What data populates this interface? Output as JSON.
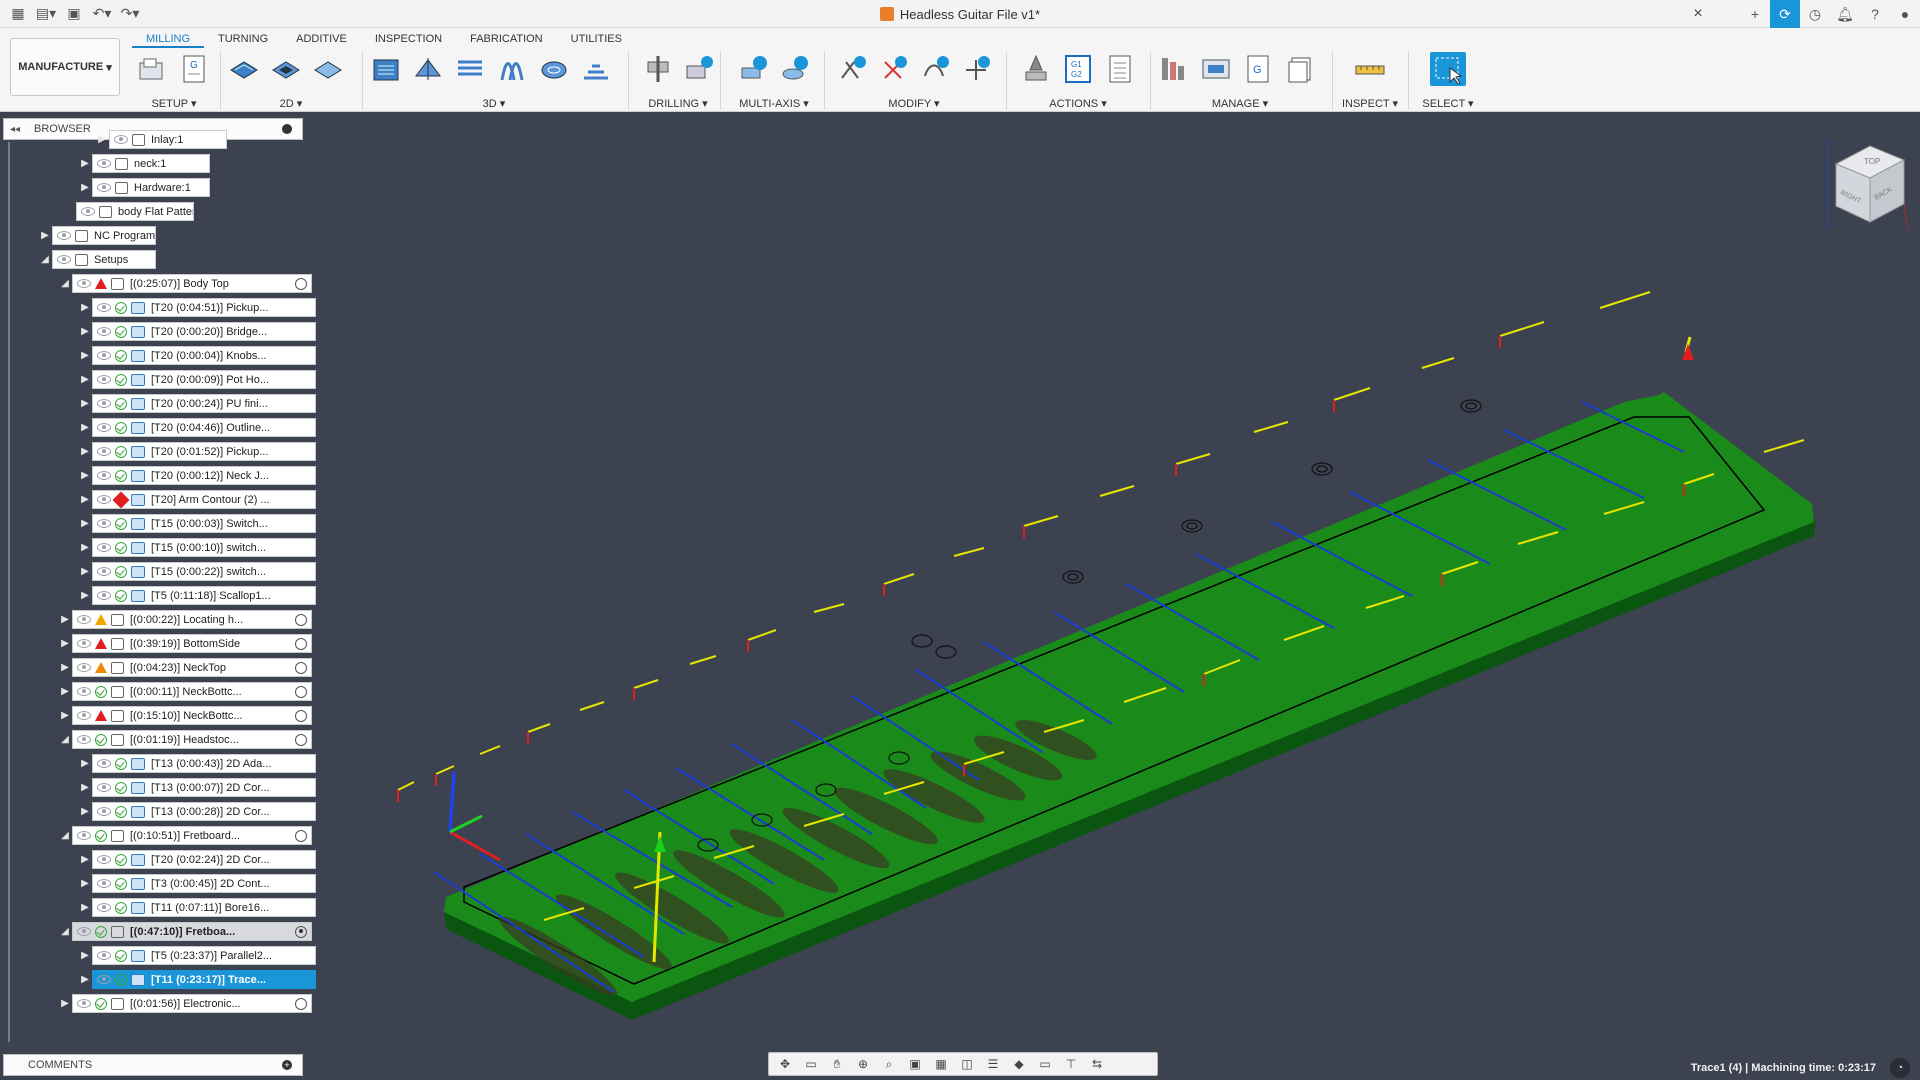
{
  "window": {
    "title": "Headless Guitar File v1*",
    "close_glyph": "×",
    "new_tab_glyph": "+"
  },
  "ribbon": {
    "workspace": "MANUFACTURE",
    "tabs": [
      "MILLING",
      "TURNING",
      "ADDITIVE",
      "INSPECTION",
      "FABRICATION",
      "UTILITIES"
    ],
    "active_tab": "MILLING",
    "groups": {
      "setup": "SETUP",
      "two_d": "2D",
      "three_d": "3D",
      "drilling": "DRILLING",
      "multi_axis": "MULTI-AXIS",
      "modify": "MODIFY",
      "actions": "ACTIONS",
      "manage": "MANAGE",
      "inspect": "INSPECT",
      "select": "SELECT"
    },
    "gcode_icon_text": "G1\nG2",
    "g_icon_text": "G"
  },
  "browser": {
    "title": "BROWSER",
    "rows": [
      {
        "label": "Inlay:1",
        "kind": "component"
      },
      {
        "label": "neck:1",
        "kind": "component"
      },
      {
        "label": "Hardware:1",
        "kind": "component"
      },
      {
        "label": "body Flat Pattern",
        "kind": "component"
      },
      {
        "label": "NC Programs",
        "kind": "folder"
      },
      {
        "label": "Setups",
        "kind": "folder"
      },
      {
        "label": "[(0:25:07)] Body Top",
        "kind": "setup-red"
      },
      {
        "label": "[T20 (0:04:51)] Pickup...",
        "kind": "op"
      },
      {
        "label": "[T20 (0:00:20)] Bridge...",
        "kind": "op"
      },
      {
        "label": "[T20 (0:00:04)] Knobs...",
        "kind": "op"
      },
      {
        "label": "[T20 (0:00:09)] Pot Ho...",
        "kind": "op"
      },
      {
        "label": "[T20 (0:00:24)] PU fini...",
        "kind": "op"
      },
      {
        "label": "[T20 (0:04:46)] Outline...",
        "kind": "op"
      },
      {
        "label": "[T20 (0:01:52)] Pickup...",
        "kind": "op"
      },
      {
        "label": "[T20 (0:00:12)] Neck J...",
        "kind": "op"
      },
      {
        "label": "[T20] Arm Contour (2) ...",
        "kind": "op-error"
      },
      {
        "label": "[T15 (0:00:03)] Switch...",
        "kind": "op"
      },
      {
        "label": "[T15 (0:00:10)] switch...",
        "kind": "op"
      },
      {
        "label": "[T15 (0:00:22)] switch...",
        "kind": "op"
      },
      {
        "label": "[T5 (0:11:18)] Scallop1...",
        "kind": "op"
      },
      {
        "label": "[(0:00:22)] Locating h...",
        "kind": "setup-yellow"
      },
      {
        "label": "[(0:39:19)] BottomSide",
        "kind": "setup-red"
      },
      {
        "label": "[(0:04:23)] NeckTop",
        "kind": "setup-orange"
      },
      {
        "label": "[(0:00:11)] NeckBottc...",
        "kind": "setup-ok"
      },
      {
        "label": "[(0:15:10)] NeckBottc...",
        "kind": "setup-red"
      },
      {
        "label": "[(0:01:19)] Headstoc...",
        "kind": "setup-ok"
      },
      {
        "label": "[T13 (0:00:43)] 2D Ada...",
        "kind": "op"
      },
      {
        "label": "[T13 (0:00:07)] 2D Cor...",
        "kind": "op"
      },
      {
        "label": "[T13 (0:00:28)] 2D Cor...",
        "kind": "op"
      },
      {
        "label": "[(0:10:51)] Fretboard...",
        "kind": "setup-ok"
      },
      {
        "label": "[T20 (0:02:24)] 2D Cor...",
        "kind": "op"
      },
      {
        "label": "[T3 (0:00:45)] 2D Cont...",
        "kind": "op"
      },
      {
        "label": "[T11 (0:07:11)] Bore16...",
        "kind": "op"
      },
      {
        "label": "[(0:47:10)] Fretboa...",
        "kind": "setup-active"
      },
      {
        "label": "[T5 (0:23:37)] Parallel2...",
        "kind": "op"
      },
      {
        "label": "[T11 (0:23:17)] Trace...",
        "kind": "op-selected"
      },
      {
        "label": "[(0:01:56)] Electronic...",
        "kind": "setup-ok"
      }
    ]
  },
  "comments": {
    "title": "COMMENTS"
  },
  "status": {
    "text": "Trace1 (4) | Machining time: 0:23:17"
  },
  "viewcube": {
    "labels": [
      "TOP",
      "RIGHT",
      "BACK"
    ]
  },
  "colors": {
    "accent": "#1a95d8",
    "background": "#3c4250",
    "model": "#0f7a1a",
    "toolpath_blue": "#1a3fd0",
    "toolpath_yellow": "#e6e600",
    "plunge_red": "#e02020"
  }
}
